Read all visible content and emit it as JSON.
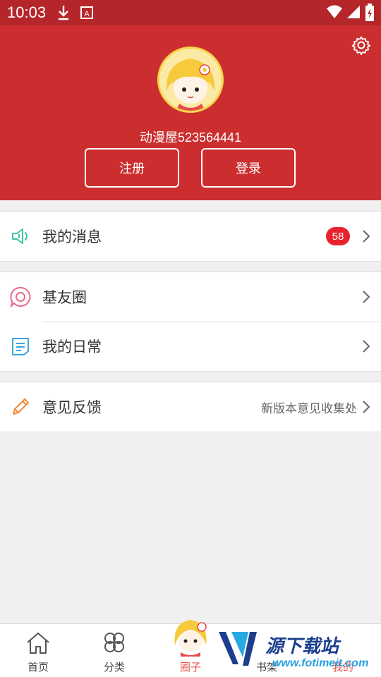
{
  "status_bar": {
    "time": "10:03"
  },
  "header": {
    "username": "动漫屋523564441",
    "register_label": "注册",
    "login_label": "登录"
  },
  "menu": {
    "messages": {
      "label": "我的消息",
      "badge": "58"
    },
    "circle": {
      "label": "基友圈"
    },
    "daily": {
      "label": "我的日常"
    },
    "feedback": {
      "label": "意见反馈",
      "hint": "新版本意见收集处"
    }
  },
  "tabs": [
    {
      "label": "首页"
    },
    {
      "label": "分类"
    },
    {
      "label": "圈子"
    },
    {
      "label": "书架"
    },
    {
      "label": "我的"
    }
  ],
  "watermark": {
    "text": "源下载站",
    "url": "www.fotimeit.com"
  },
  "colors": {
    "brand_red": "#cc2e2f",
    "badge_red": "#e8232f",
    "tab_active": "#e65c52"
  }
}
